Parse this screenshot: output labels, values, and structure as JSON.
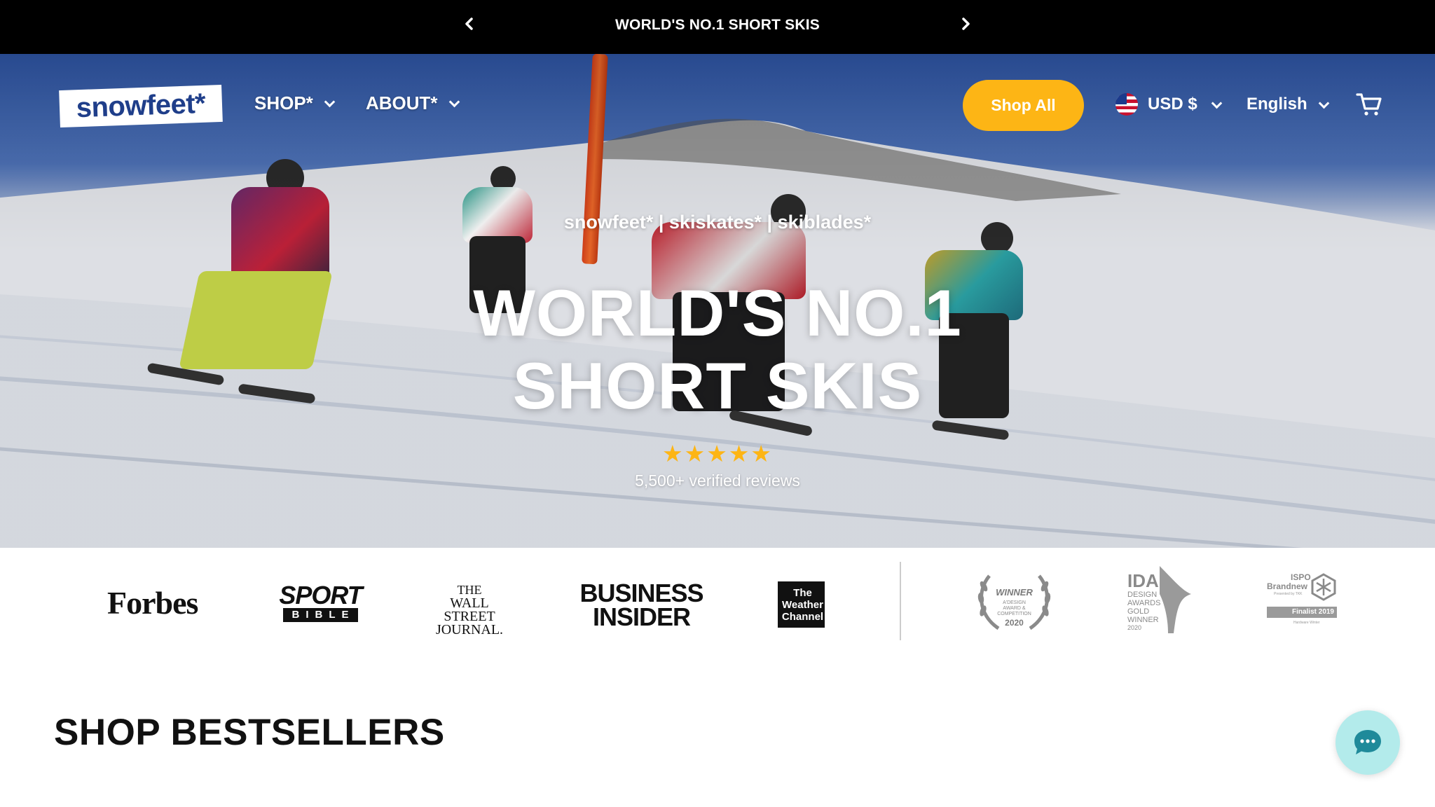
{
  "announcement": {
    "text": "WORLD'S NO.1 SHORT SKIS",
    "prev_icon": "chevron-left-icon",
    "next_icon": "chevron-right-icon"
  },
  "header": {
    "logo": "snowfeet*",
    "nav": [
      {
        "label": "SHOP*"
      },
      {
        "label": "ABOUT*"
      }
    ],
    "cta": "Shop All",
    "currency": "USD $",
    "language": "English",
    "cart_icon": "cart-icon",
    "colors": {
      "accent": "#fdb515",
      "logo_blue": "#1f3e8a"
    }
  },
  "hero": {
    "tagline": "snowfeet* | skiskates* | skiblades*",
    "headline_line1": "WORLD'S NO.1",
    "headline_line2": "SHORT SKIS",
    "rating_stars": 5,
    "stars": "★★★★★",
    "reviews": "5,500+ verified reviews"
  },
  "press": {
    "forbes": "Forbes",
    "sportbible_top": "SPORT",
    "sportbible_bottom": "BIBLE",
    "wsj": [
      "THE",
      "WALL STREET",
      "JOURNAL."
    ],
    "bi": [
      "BUSINESS",
      "INSIDER"
    ],
    "twc": [
      "The",
      "Weather",
      "Channel"
    ],
    "award1": {
      "title": "WINNER",
      "sub": "A'DESIGN AWARD & COMPETITION",
      "year": "2020"
    },
    "award2": {
      "lines": [
        "IDA",
        "DESIGN",
        "AWARDS",
        "GOLD",
        "WINNER",
        "2020"
      ]
    },
    "award3": {
      "lines": [
        "ISPO",
        "Brandnew"
      ],
      "sub": "Presented by TKK",
      "badge": "Finalist 2019",
      "foot": "Hardware Winter"
    }
  },
  "section": {
    "title": "SHOP BESTSELLERS"
  },
  "chat": {
    "icon": "chat-bubble-icon"
  }
}
